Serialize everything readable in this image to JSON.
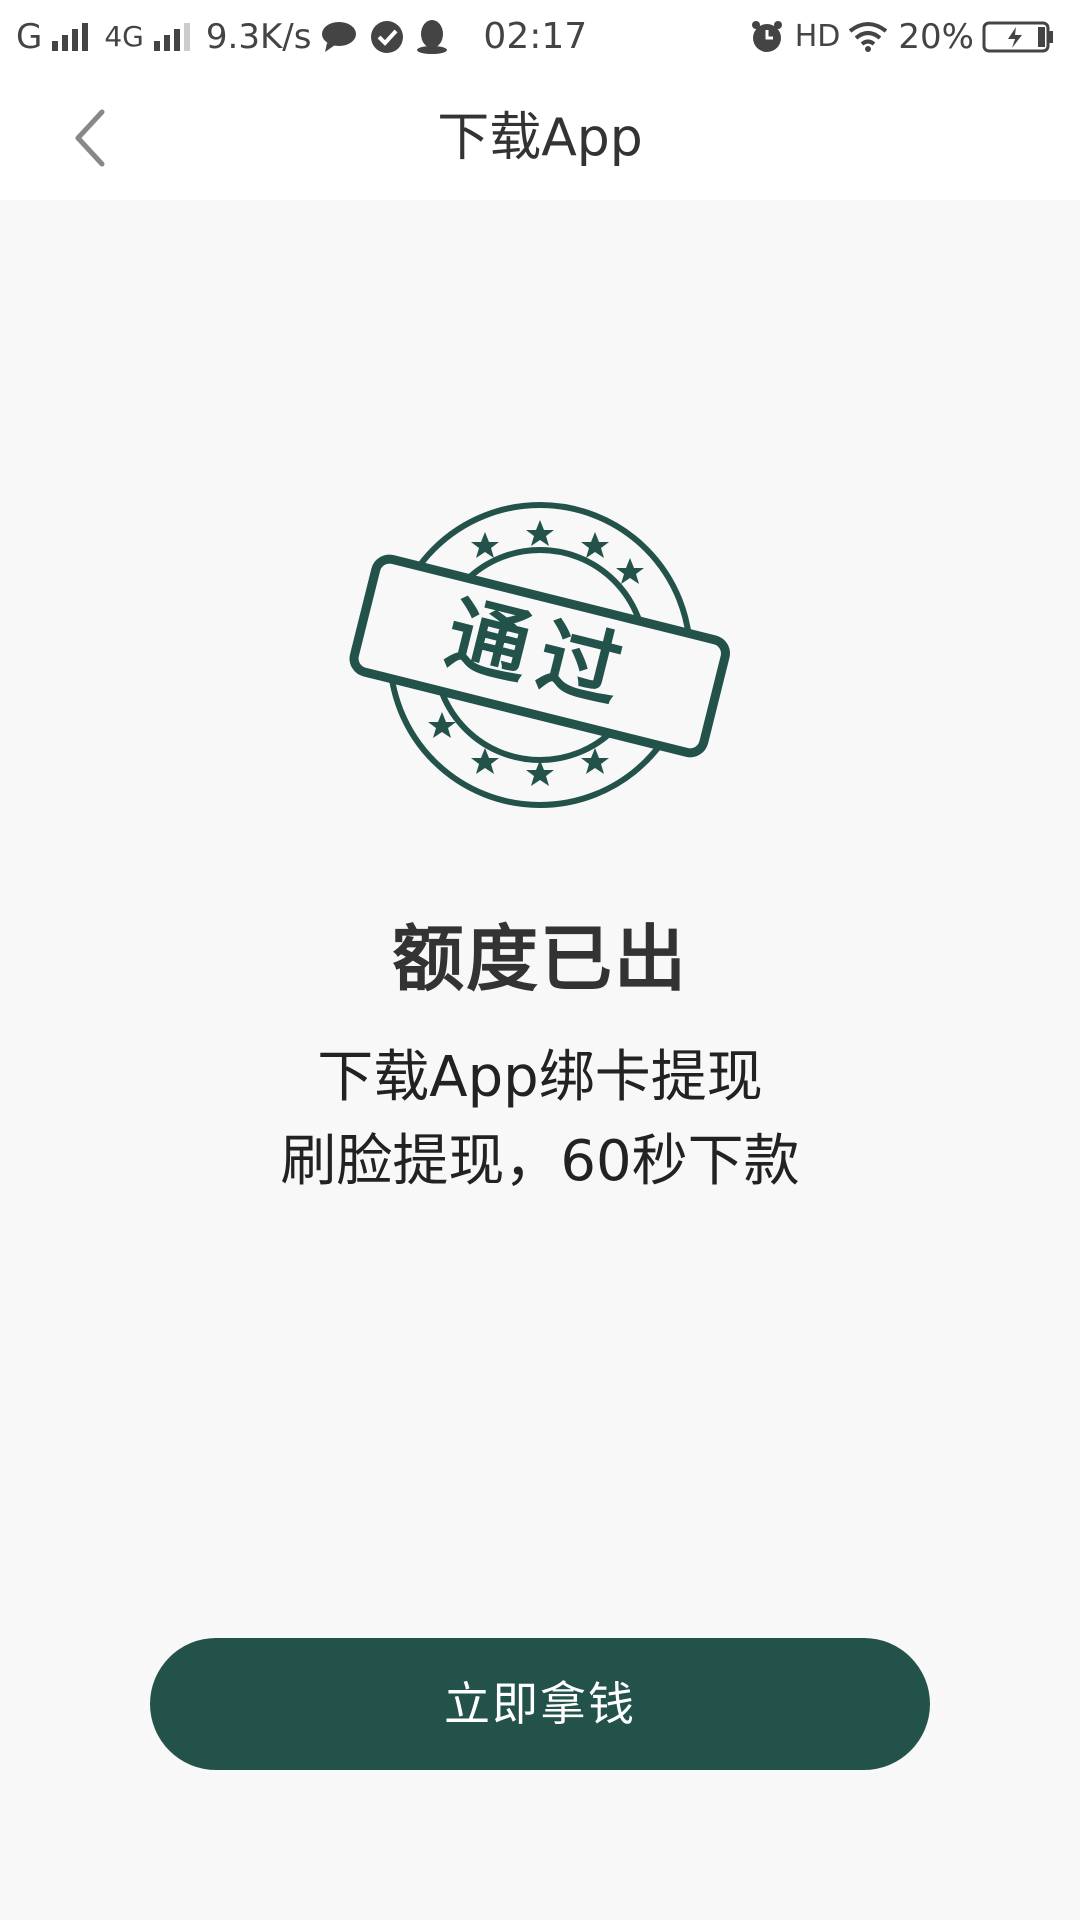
{
  "status_bar": {
    "carrier1": "G",
    "carrier2": "4G",
    "speed": "9.3K/s",
    "time": "02:17",
    "hd": "HD",
    "battery": "20%",
    "icons": [
      "signal-icon",
      "chat-icon",
      "check-circle-icon",
      "qq-penguin-icon",
      "alarm-icon",
      "wifi-icon",
      "battery-icon"
    ]
  },
  "nav": {
    "title": "下载App",
    "back_icon": "chevron-left-icon"
  },
  "stamp": {
    "text": "通过",
    "color": "#22524a"
  },
  "content": {
    "headline": "额度已出",
    "line1": "下载App绑卡提现",
    "line2": "刷脸提现，60秒下款"
  },
  "cta": {
    "label": "立即拿钱",
    "color": "#22524a"
  }
}
